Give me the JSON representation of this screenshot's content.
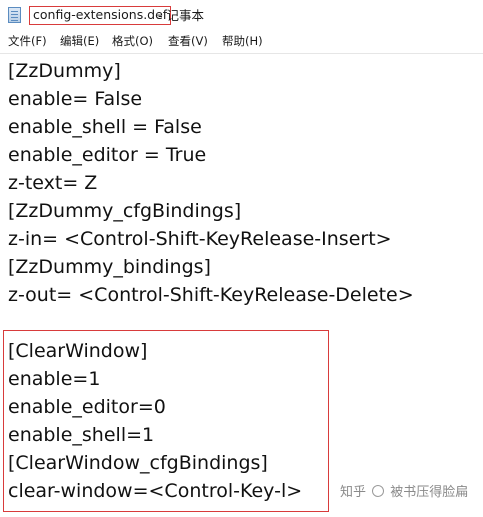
{
  "title": {
    "file_name": "config-extensions.def",
    "rest": "- 记事本"
  },
  "menu": [
    {
      "label": "文件(F)"
    },
    {
      "label": "编辑(E)"
    },
    {
      "label": "格式(O)"
    },
    {
      "label": "查看(V)"
    },
    {
      "label": "帮助(H)"
    }
  ],
  "editor": {
    "lines": [
      "[ZzDummy]",
      "enable= False",
      "enable_shell = False",
      "enable_editor = True",
      "z-text= Z",
      "[ZzDummy_cfgBindings]",
      "z-in= <Control-Shift-KeyRelease-Insert>",
      "[ZzDummy_bindings]",
      "z-out= <Control-Shift-KeyRelease-Delete>",
      "",
      "[ClearWindow]",
      "enable=1",
      "enable_editor=0",
      "enable_shell=1",
      "[ClearWindow_cfgBindings]",
      "clear-window=<Control-Key-l>"
    ]
  },
  "watermark": {
    "site": "知乎",
    "author": "被书压得脸扁"
  },
  "colors": {
    "highlight_border": "#d83b3b",
    "text": "#111111",
    "background": "#ffffff"
  }
}
